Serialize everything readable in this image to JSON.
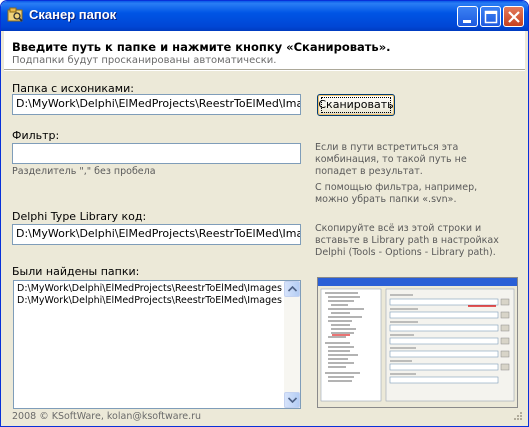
{
  "window": {
    "title": "Сканер папок"
  },
  "header": {
    "title": "Введите путь к папке и нажмите кнопку «Сканировать».",
    "subtitle": "Подпапки будут просканированы автоматически."
  },
  "source": {
    "label": "Папка с исхониками:",
    "value": "D:\\MyWork\\Delphi\\ElMedProjects\\ReestrToElMed\\Images",
    "scan_button": "Сканировать"
  },
  "filter": {
    "label": "Фильтр:",
    "value": "",
    "hint": "Разделитель \",\" без пробела"
  },
  "notes": {
    "note1": "Если в пути встретиться эта комбинация, то такой путь не попадет в результат.",
    "note2": "С помощью фильтра, например, можно убрать папки «.svn».",
    "note3": "Скопируйте всё из этой строки и вставьте в Library path в настройках Delphi (Tools - Options - Library path)."
  },
  "typelib": {
    "label": "Delphi Type Library код:",
    "value": "D:\\MyWork\\Delphi\\ElMedProjects\\ReestrToElMed\\Images;D:\\MyWork\\Delphi\\ElMedProjects\\ReestrToElMed\\Images\\Graphics"
  },
  "results": {
    "label": "Были найдены папки:",
    "items": [
      "D:\\MyWork\\Delphi\\ElMedProjects\\ReestrToElMed\\Images\\Graphics",
      "D:\\MyWork\\Delphi\\ElMedProjects\\ReestrToElMed\\Images\\Icons"
    ]
  },
  "footer": {
    "copyright": "2008 © KSoftWare, kolan@ksoftware.ru"
  },
  "colors": {
    "titlebar": "#0054e3",
    "window_bg": "#ece9d8",
    "input_border": "#7f9db9"
  },
  "icons": [
    "app-icon",
    "minimize-icon",
    "maximize-icon",
    "close-icon",
    "arrow-down-icon",
    "resize-grip-icon"
  ]
}
